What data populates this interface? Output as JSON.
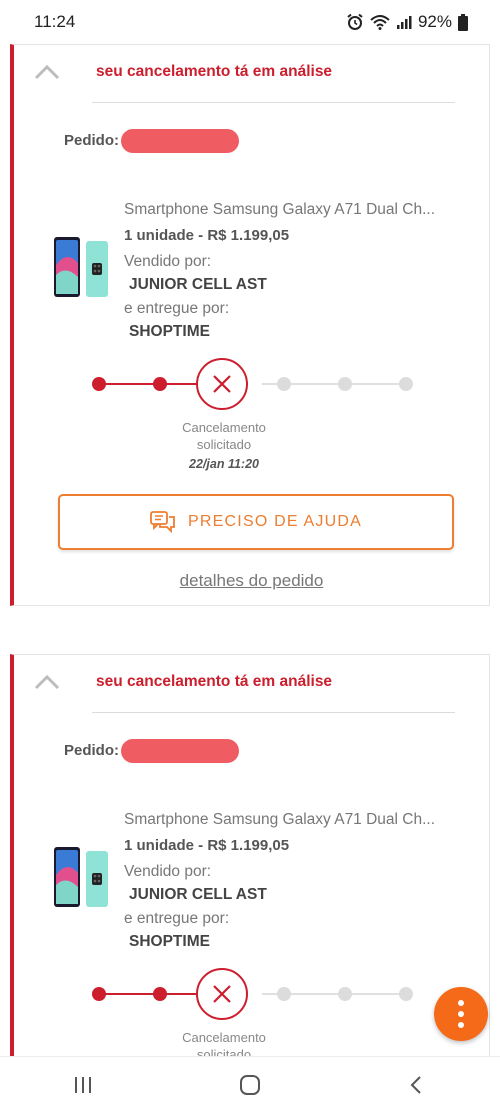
{
  "status_bar": {
    "time": "11:24",
    "battery": "92%",
    "icons": [
      "alarm-icon",
      "wifi-icon",
      "signal-icon",
      "battery-icon"
    ]
  },
  "orders": [
    {
      "status_title": "seu cancelamento tá em análise",
      "order_label": "Pedido:",
      "product_name": "Smartphone Samsung Galaxy A71 Dual Ch...",
      "quantity_price": "1 unidade - R$ 1.199,05",
      "sold_by_label": "Vendido por:",
      "seller": "JUNIOR CELL AST",
      "delivered_by_label": "e entregue por:",
      "deliverer": "SHOPTIME",
      "step_caption_line1": "Cancelamento",
      "step_caption_line2": "solicitado",
      "step_date": "22/jan 11:20",
      "help_label": "PRECISO DE AJUDA",
      "details_link": "detalhes do pedido"
    },
    {
      "status_title": "seu cancelamento tá em análise",
      "order_label": "Pedido:",
      "product_name": "Smartphone Samsung Galaxy A71 Dual Ch...",
      "quantity_price": "1 unidade - R$ 1.199,05",
      "sold_by_label": "Vendido por:",
      "seller": "JUNIOR CELL AST",
      "delivered_by_label": "e entregue por:",
      "deliverer": "SHOPTIME",
      "step_caption_line1": "Cancelamento",
      "step_caption_line2": "solicitado"
    }
  ],
  "timeline": {
    "completed_steps": 2,
    "current_step": "cancelled",
    "remaining_steps": 3
  },
  "colors": {
    "accent_red": "#cc1e2d",
    "accent_orange": "#ed7d31",
    "fab_orange": "#f56a18"
  },
  "fab": {
    "icon": "more-vertical-icon"
  },
  "nav_bar": {
    "icons": [
      "recent-apps-icon",
      "home-icon",
      "back-icon"
    ]
  }
}
